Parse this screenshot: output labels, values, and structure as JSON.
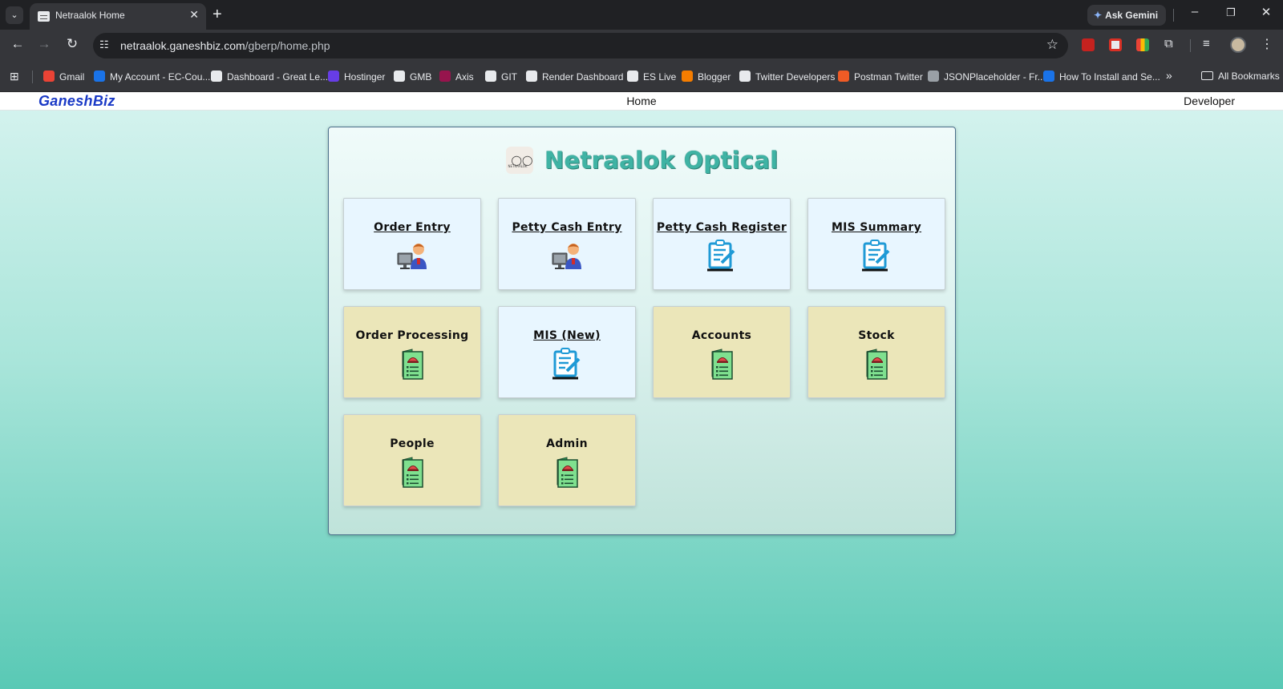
{
  "browser": {
    "tab_title": "Netraalok Home",
    "url_host": "netraalok.ganeshbiz.com",
    "url_path": "/gberp/home.php",
    "gemini_label": "Ask Gemini",
    "bookmarks": [
      {
        "label": "Gmail",
        "color": "#ea4335"
      },
      {
        "label": "My Account - EC-Cou...",
        "color": "#1a73e8"
      },
      {
        "label": "Dashboard - Great Le...",
        "color": "#e8eaed"
      },
      {
        "label": "Hostinger",
        "color": "#673de6"
      },
      {
        "label": "GMB",
        "color": "#e8eaed"
      },
      {
        "label": "Axis",
        "color": "#97144d"
      },
      {
        "label": "GIT",
        "color": "#e8eaed"
      },
      {
        "label": "Render Dashboard",
        "color": "#e8eaed"
      },
      {
        "label": "ES Live",
        "color": "#e8eaed"
      },
      {
        "label": "Blogger",
        "color": "#f57d00"
      },
      {
        "label": "Twitter Developers",
        "color": "#e8eaed"
      },
      {
        "label": "Postman Twitter",
        "color": "#ef5b25"
      },
      {
        "label": "JSONPlaceholder - Fr...",
        "color": "#9aa0a6"
      },
      {
        "label": "How To Install and Se...",
        "color": "#1a73e8"
      }
    ],
    "all_bookmarks_label": "All Bookmarks"
  },
  "topnav": {
    "logo": "GaneshBiz",
    "home": "Home",
    "developer": "Developer"
  },
  "panel": {
    "brand_title": "Netraalok Optical",
    "brand_logo_text": "NETRAALOK"
  },
  "menu": [
    {
      "label": "Order Entry",
      "style": "blue",
      "link": true,
      "icon": "user-computer-icon"
    },
    {
      "label": "Petty Cash Entry",
      "style": "blue",
      "link": true,
      "icon": "user-computer-icon"
    },
    {
      "label": "Petty Cash Register",
      "style": "blue",
      "link": true,
      "icon": "clipboard-edit-icon"
    },
    {
      "label": "MIS Summary",
      "style": "blue",
      "link": true,
      "icon": "clipboard-edit-icon"
    },
    {
      "label": "Order Processing",
      "style": "tan",
      "link": false,
      "icon": "service-menu-icon"
    },
    {
      "label": "MIS (New)",
      "style": "blue",
      "link": true,
      "icon": "clipboard-edit-icon"
    },
    {
      "label": "Accounts",
      "style": "tan",
      "link": false,
      "icon": "service-menu-icon"
    },
    {
      "label": "Stock",
      "style": "tan",
      "link": false,
      "icon": "service-menu-icon"
    },
    {
      "label": "People",
      "style": "tan",
      "link": false,
      "icon": "service-menu-icon"
    },
    {
      "label": "Admin",
      "style": "tan",
      "link": false,
      "icon": "service-menu-icon"
    }
  ],
  "colors": {
    "card_blue": "#e8f6ff",
    "card_tan": "#ebe6b9",
    "brand_teal": "#3fb3a4",
    "logo_blue": "#1939c6"
  }
}
